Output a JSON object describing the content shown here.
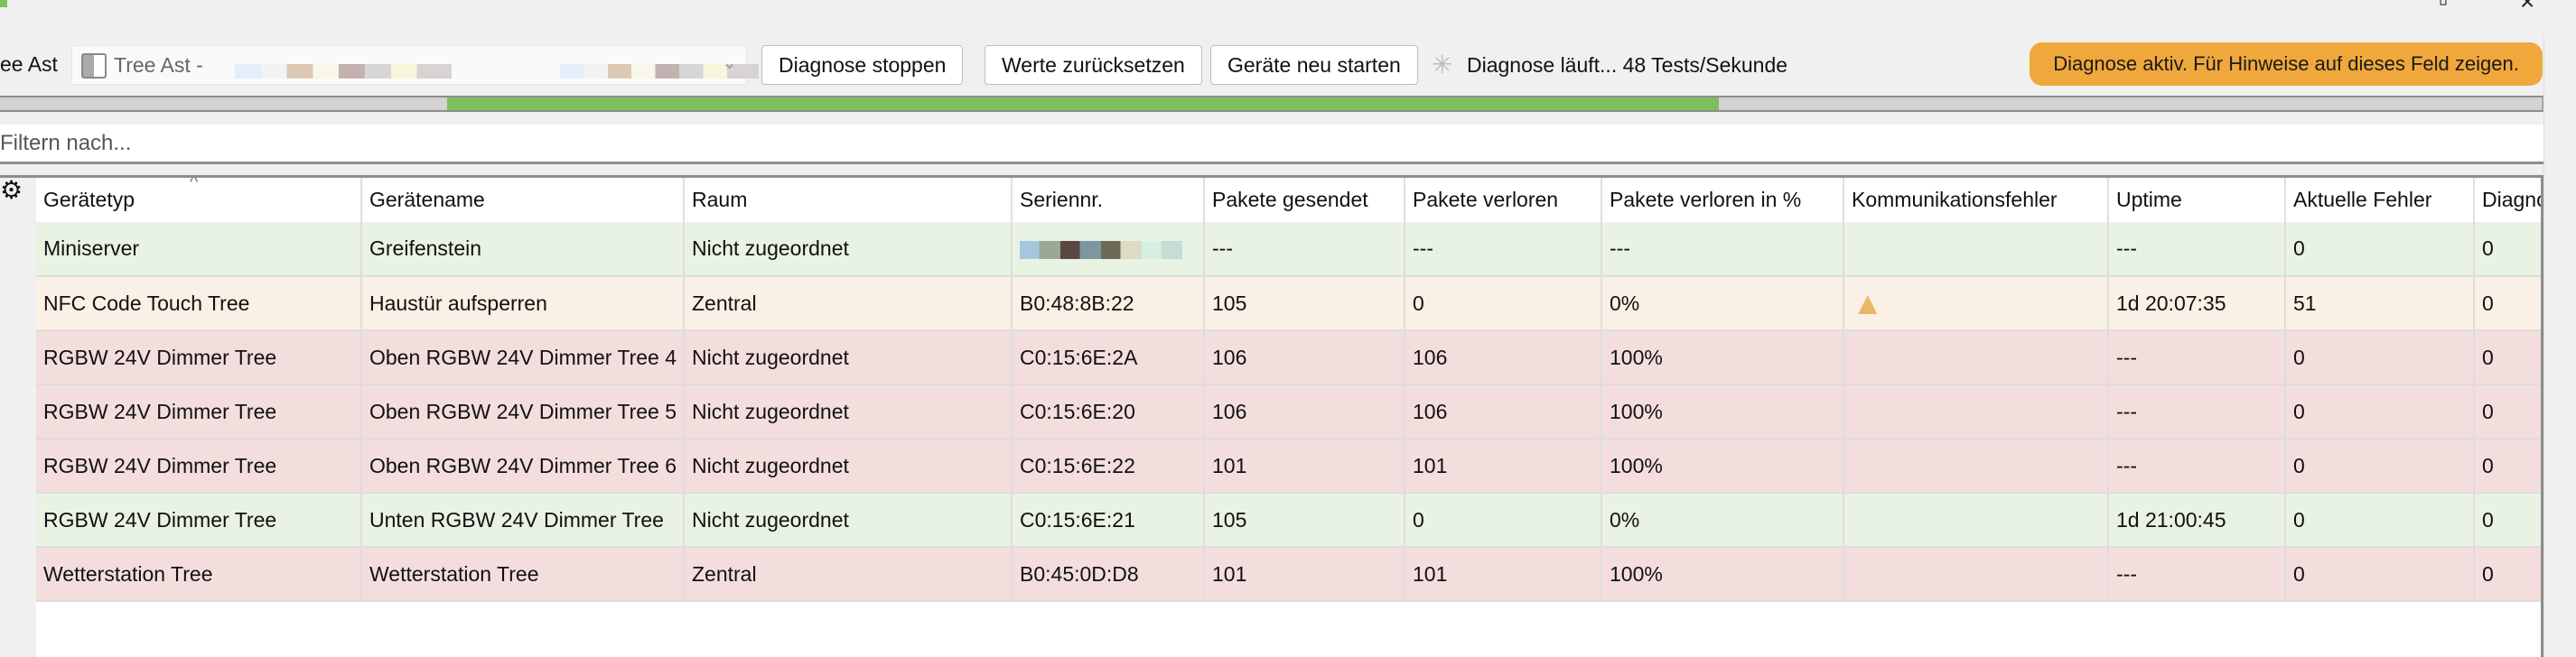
{
  "window": {
    "minimize_icon": "minimize-icon",
    "close_icon": "close-icon"
  },
  "toolbar": {
    "tree_label": "ee Ast",
    "tree_select_value": "Tree Ast -",
    "stop_button": "Diagnose stoppen",
    "reset_button": "Werte zurücksetzen",
    "restart_button": "Geräte neu starten",
    "status_text": "Diagnose läuft...",
    "rate_text": "48 Tests/Sekunde",
    "active_badge": "Diagnose aktiv. Für Hinweise auf dieses Feld zeigen."
  },
  "progress": {
    "mode": "indeterminate",
    "segment_start": 0.176,
    "segment_end": 0.676,
    "color": "#7dbf5d"
  },
  "filter": {
    "placeholder": "Filtern nach...",
    "value": ""
  },
  "table": {
    "columns": [
      "Gerätetyp",
      "Gerätename",
      "Raum",
      "Seriennr.",
      "Pakete gesendet",
      "Pakete verloren",
      "Pakete verloren in %",
      "Kommunikationsfehler",
      "Uptime",
      "Aktuelle Fehler",
      "Diagnosefehler"
    ],
    "sorted_column": "Gerätetyp",
    "rows": [
      {
        "status": "ok",
        "cells": [
          "Miniserver",
          "Greifenstein",
          "Nicht zugeordnet",
          "",
          "---",
          "---",
          "---",
          "",
          "---",
          "0",
          "0"
        ],
        "serial_masked": true,
        "comm_warning": false
      },
      {
        "status": "warn",
        "cells": [
          "NFC Code Touch Tree",
          "Haustür aufsperren",
          "Zentral",
          "B0:48:8B:22",
          "105",
          "0",
          "0%",
          "",
          "1d 20:07:35",
          "51",
          "0"
        ],
        "serial_masked": false,
        "comm_warning": true
      },
      {
        "status": "err",
        "cells": [
          "RGBW 24V Dimmer Tree",
          "Oben RGBW 24V Dimmer Tree 4",
          "Nicht zugeordnet",
          "C0:15:6E:2A",
          "106",
          "106",
          "100%",
          "",
          "---",
          "0",
          "0"
        ],
        "serial_masked": false,
        "comm_warning": false
      },
      {
        "status": "err",
        "cells": [
          "RGBW 24V Dimmer Tree",
          "Oben RGBW 24V Dimmer Tree 5",
          "Nicht zugeordnet",
          "C0:15:6E:20",
          "106",
          "106",
          "100%",
          "",
          "---",
          "0",
          "0"
        ],
        "serial_masked": false,
        "comm_warning": false
      },
      {
        "status": "err",
        "cells": [
          "RGBW 24V Dimmer Tree",
          "Oben RGBW 24V Dimmer Tree 6",
          "Nicht zugeordnet",
          "C0:15:6E:22",
          "101",
          "101",
          "100%",
          "",
          "---",
          "0",
          "0"
        ],
        "serial_masked": false,
        "comm_warning": false
      },
      {
        "status": "ok",
        "cells": [
          "RGBW 24V Dimmer Tree",
          "Unten RGBW 24V Dimmer Tree",
          "Nicht zugeordnet",
          "C0:15:6E:21",
          "105",
          "0",
          "0%",
          "",
          "1d 21:00:45",
          "0",
          "0"
        ],
        "serial_masked": false,
        "comm_warning": false
      },
      {
        "status": "err",
        "cells": [
          "Wetterstation Tree",
          "Wetterstation Tree",
          "Zentral",
          "B0:45:0D:D8",
          "101",
          "101",
          "100%",
          "",
          "---",
          "0",
          "0"
        ],
        "serial_masked": false,
        "comm_warning": false
      }
    ]
  },
  "colors": {
    "ok": "#e8f3e3",
    "warn": "#fbf0e5",
    "err": "#f4dddd",
    "badge": "#f0a73b"
  }
}
